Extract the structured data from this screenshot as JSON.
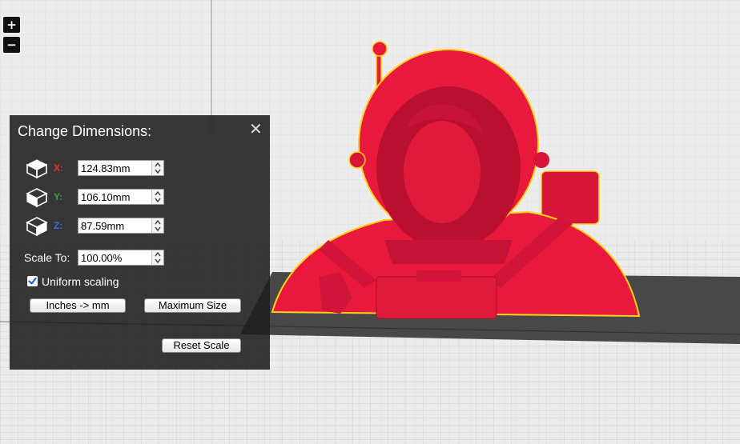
{
  "zoom_controls": {
    "zoom_in_label": "+",
    "zoom_out_label": "−"
  },
  "dimensions_panel": {
    "title": "Change Dimensions:",
    "close_label": "✕",
    "axes": [
      {
        "label": "X:",
        "value": "124.83mm",
        "color": "#e8322f"
      },
      {
        "label": "Y:",
        "value": "106.10mm",
        "color": "#2ea83a"
      },
      {
        "label": "Z:",
        "value": "87.59mm",
        "color": "#2f6fe0"
      }
    ],
    "scale_label": "Scale To:",
    "scale_value": "100.00%",
    "uniform_scaling_label": "Uniform scaling",
    "uniform_scaling_checked": true,
    "inches_to_mm_label": "Inches -> mm",
    "maximum_size_label": "Maximum Size",
    "reset_scale_label": "Reset Scale"
  },
  "model": {
    "color": "#e8193c",
    "outline_color": "#ffd21a"
  }
}
